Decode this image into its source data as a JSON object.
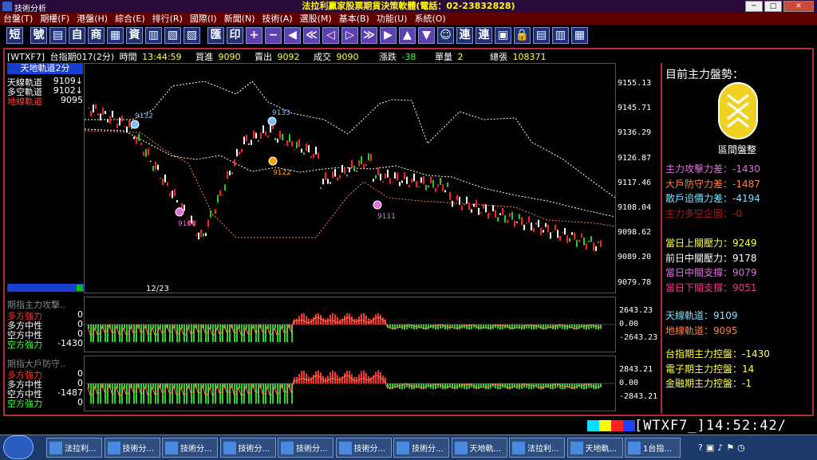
{
  "window": {
    "title": "技術分析",
    "app_banner": "法拉利贏家股票期貨決策軟體(電話：02-23832828)"
  },
  "menu": [
    "台盤(T)",
    "期權(F)",
    "港盤(H)",
    "綜合(E)",
    "排行(R)",
    "國際(I)",
    "新聞(N)",
    "技術(A)",
    "選股(M)",
    "基本(B)",
    "功能(U)",
    "系統(O)"
  ],
  "toolbar": [
    "短",
    "號",
    "▤",
    "自",
    "商",
    "▦",
    "資",
    "▥",
    "▧",
    "▨",
    "匯",
    "印",
    "+",
    "−",
    "◀",
    "≪",
    "◁",
    "▷",
    "≫",
    "▶",
    "▲",
    "▼",
    "☺",
    "連",
    "連",
    "▣",
    "🔒",
    "▤",
    "▥",
    "▦"
  ],
  "quote": {
    "symbol": "[WTXF7]",
    "period": "台指期017(2分)",
    "time_label": "時間",
    "time": "13:44:59",
    "bid_label": "買進",
    "bid": "9090",
    "ask_label": "賣出",
    "ask": "9092",
    "last_label": "成交",
    "last": "9090",
    "chg_label": "漲跌",
    "chg": "-38",
    "vol_label": "單量",
    "vol": "2",
    "total_label": "總張",
    "total": "108371"
  },
  "legend": {
    "head": "天地軌道2分",
    "rows": [
      {
        "name": "天線軌道",
        "value": "9109↓",
        "color": "#ffffff"
      },
      {
        "name": "多空軌道",
        "value": "9102↓",
        "color": "#ffffff"
      },
      {
        "name": "地線軌道",
        "value": "9095",
        "color": "#ff4040"
      }
    ]
  },
  "main_axis": [
    "9155.13",
    "9145.71",
    "9136.29",
    "9126.87",
    "9117.46",
    "9108.04",
    "9098.62",
    "9089.20",
    "9079.78"
  ],
  "markers": [
    {
      "label": "9132",
      "color": "#80c0ff"
    },
    {
      "label": "9133",
      "color": "#80c0ff"
    },
    {
      "label": "9122",
      "color": "#ffa500"
    },
    {
      "label": "9108",
      "color": "#e070e0"
    },
    {
      "label": "9111",
      "color": "#e070e0"
    }
  ],
  "date_label": "12/23",
  "sub1": {
    "title": "期指主力攻擊..",
    "rows": [
      {
        "name": "多方強力",
        "value": "0",
        "color": "#ff3030"
      },
      {
        "name": "多方中性",
        "value": "0",
        "color": "#ffffff"
      },
      {
        "name": "空方中性",
        "value": "0",
        "color": "#ffffff"
      },
      {
        "name": "空方強力",
        "value": "-1430",
        "color": "#40ff40"
      }
    ],
    "axis": [
      "2643.23",
      "0.00",
      "-2643.23"
    ]
  },
  "sub2": {
    "title": "期指大戶防守..",
    "rows": [
      {
        "name": "多方強力",
        "value": "0",
        "color": "#ff3030"
      },
      {
        "name": "多方中性",
        "value": "0",
        "color": "#ffffff"
      },
      {
        "name": "空方中性",
        "value": "-1487",
        "color": "#ffffff"
      },
      {
        "name": "空方強力",
        "value": "0",
        "color": "#40ff40"
      }
    ],
    "axis": [
      "2843.21",
      "0.00",
      "-2843.21"
    ]
  },
  "panel": {
    "title": "目前主力盤勢：",
    "badge": "區間盤整",
    "metrics": [
      {
        "label": "主力攻擊力差：",
        "value": "-1430",
        "color": "#e070e0"
      },
      {
        "label": "大戶防守力差：",
        "value": "-1487",
        "color": "#ff8040"
      },
      {
        "label": "散戶追價力差：",
        "value": "-4194",
        "color": "#80e0ff"
      },
      {
        "label": "主力多空企圖：",
        "value": "-0",
        "color": "#a02020"
      }
    ],
    "levels": [
      {
        "label": "當日上關壓力：",
        "value": "9249",
        "color": "#ffff40"
      },
      {
        "label": "前日中關壓力：",
        "value": "9178",
        "color": "#ffffff"
      },
      {
        "label": "當日中關支撐：",
        "value": "9079",
        "color": "#e070e0"
      },
      {
        "label": "當日下關支撐：",
        "value": "9051",
        "color": "#ff3090"
      }
    ],
    "orbits": [
      {
        "label": "天線軌道：",
        "value": "9109",
        "color": "#80e0ff"
      },
      {
        "label": "地線軌道：",
        "value": "9095",
        "color": "#ff8040"
      }
    ],
    "control": [
      {
        "label": "台指期主力控盤：",
        "value": "-1430",
        "color": "#ffff40"
      },
      {
        "label": "電子期主力控盤：",
        "value": "14",
        "color": "#ffff40"
      },
      {
        "label": "金融期主力控盤：",
        "value": "-1",
        "color": "#ffff40"
      }
    ]
  },
  "status": {
    "ticker": "[WTXF7_]14:52:42/"
  },
  "taskbar": [
    "法拉利...",
    "技術分...",
    "技術分...",
    "技術分...",
    "技術分...",
    "技術分...",
    "技術分...",
    "天地軌...",
    "法拉利...",
    "天地軌...",
    "1台指..."
  ]
}
